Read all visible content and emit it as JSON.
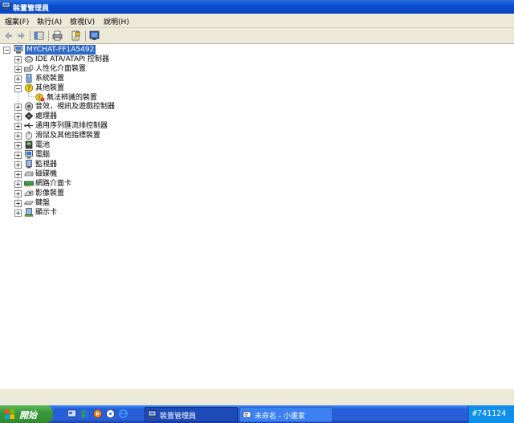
{
  "window": {
    "title": "裝置管理員",
    "icon": "device-manager-icon"
  },
  "menu": {
    "items": [
      "檔案(F)",
      "執行(A)",
      "檢視(V)",
      "說明(H)"
    ]
  },
  "toolbar": {
    "buttons": [
      "back-icon",
      "forward-icon",
      "show-hide-tree-icon",
      "print-icon",
      "properties-icon",
      "help-icon"
    ]
  },
  "tree": {
    "root": "MYCHAT-FF1A5492",
    "items": [
      {
        "label": "IDE ATA/ATAPI 控制器",
        "icon": "ide-controller-icon",
        "expander": "+"
      },
      {
        "label": "人性化介面裝置",
        "icon": "hid-icon",
        "expander": "+"
      },
      {
        "label": "系統裝置",
        "icon": "system-device-icon",
        "expander": "+"
      },
      {
        "label": "其他裝置",
        "icon": "other-devices-icon",
        "expander": "−",
        "children": [
          {
            "label": "無法辨識的裝置",
            "icon": "unknown-device-warning-icon"
          }
        ]
      },
      {
        "label": "音效，視訊及遊戲控制器",
        "icon": "sound-icon",
        "expander": "+"
      },
      {
        "label": "處理器",
        "icon": "processor-icon",
        "expander": "+"
      },
      {
        "label": "通用序列匯流排控制器",
        "icon": "usb-icon",
        "expander": "+"
      },
      {
        "label": "滑鼠及其他指標裝置",
        "icon": "mouse-icon",
        "expander": "+"
      },
      {
        "label": "電池",
        "icon": "battery-icon",
        "expander": "+"
      },
      {
        "label": "電腦",
        "icon": "computer-icon",
        "expander": "+"
      },
      {
        "label": "監視器",
        "icon": "monitor-icon",
        "expander": "+"
      },
      {
        "label": "磁碟機",
        "icon": "disk-drive-icon",
        "expander": "+"
      },
      {
        "label": "網路介面卡",
        "icon": "network-adapter-icon",
        "expander": "+"
      },
      {
        "label": "影像裝置",
        "icon": "imaging-icon",
        "expander": "+"
      },
      {
        "label": "鍵盤",
        "icon": "keyboard-icon",
        "expander": "+"
      },
      {
        "label": "顯示卡",
        "icon": "display-adapter-icon",
        "expander": "+"
      }
    ]
  },
  "taskbar": {
    "start_label": "開始",
    "tasks": [
      {
        "label": "裝置管理員",
        "icon": "device-manager-icon",
        "active": true
      },
      {
        "label": "未命名 - 小畫家",
        "icon": "paint-icon",
        "active": false
      }
    ],
    "clock": "#741124"
  },
  "colors": {
    "title_blue": "#0a4fd0",
    "selection": "#316ac5",
    "taskbar_blue": "#245edb",
    "start_green": "#3a9a3a"
  }
}
